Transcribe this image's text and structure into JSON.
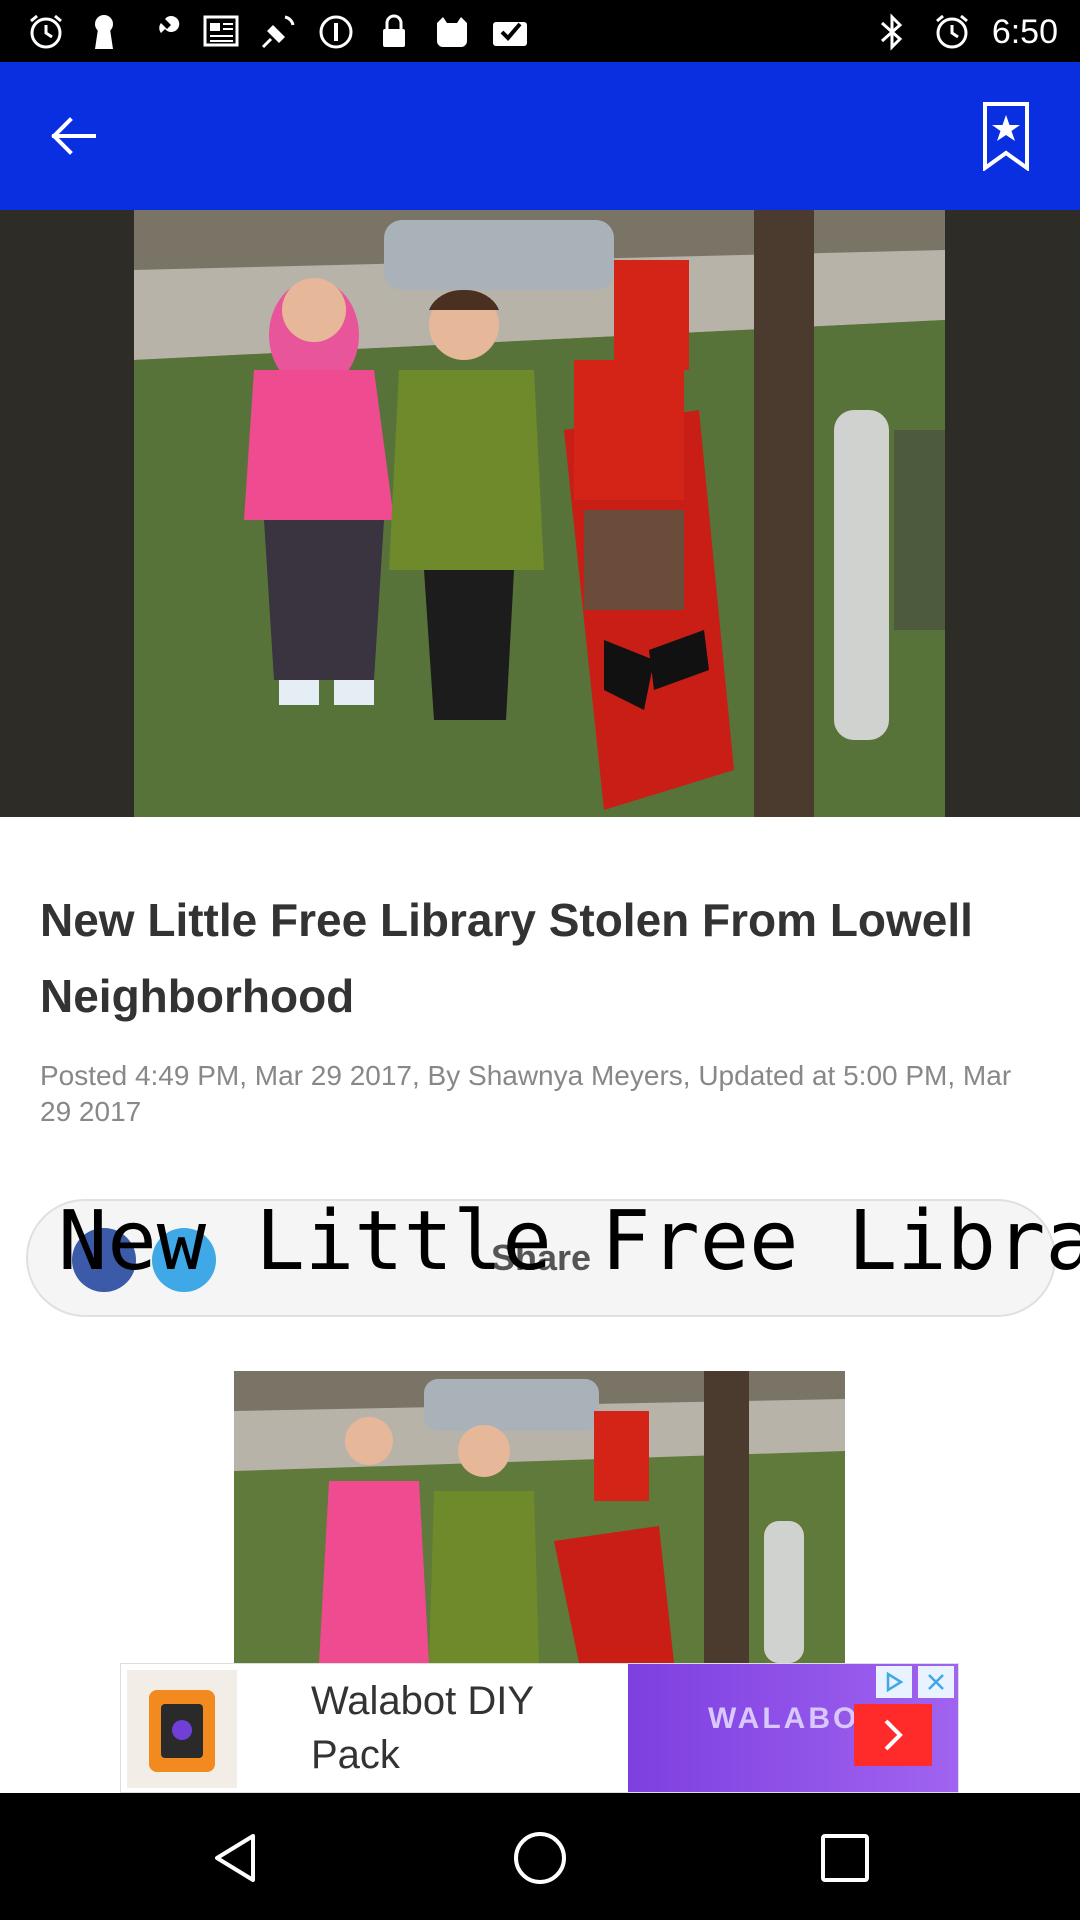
{
  "status_bar": {
    "time": "6:50",
    "left_icons": [
      "alarm-icon",
      "keyhole-icon",
      "wrench-icon",
      "news-icon",
      "satellite-icon",
      "info-icon",
      "lock-icon",
      "cat-icon",
      "mail-check-icon"
    ],
    "right_icons": [
      "bluetooth-icon",
      "alarm-icon"
    ]
  },
  "app_bar": {
    "color": "#0a2fe0",
    "back_icon": "arrow-left-icon",
    "bookmark_icon": "bookmark-star-icon"
  },
  "article": {
    "headline": "New Little Free Library Stolen From Lowell Neighborhood",
    "byline": "Posted 4:49 PM, Mar 29 2017, By Shawnya Meyers, Updated at 5:00 PM, Mar 29 2017"
  },
  "share_bar": {
    "label": "Share",
    "overlay_text": "New Little Free Library",
    "facebook_color": "#3b5aa8",
    "twitter_color": "#3fa8e6"
  },
  "ad": {
    "text": "Walabot DIY Pack",
    "brand": "WALABOT",
    "info_icon": "ad-choices-icon",
    "close_icon": "close-icon"
  },
  "nav_bar": {
    "back_icon": "triangle-back-icon",
    "home_icon": "circle-home-icon",
    "recents_icon": "square-recents-icon"
  }
}
